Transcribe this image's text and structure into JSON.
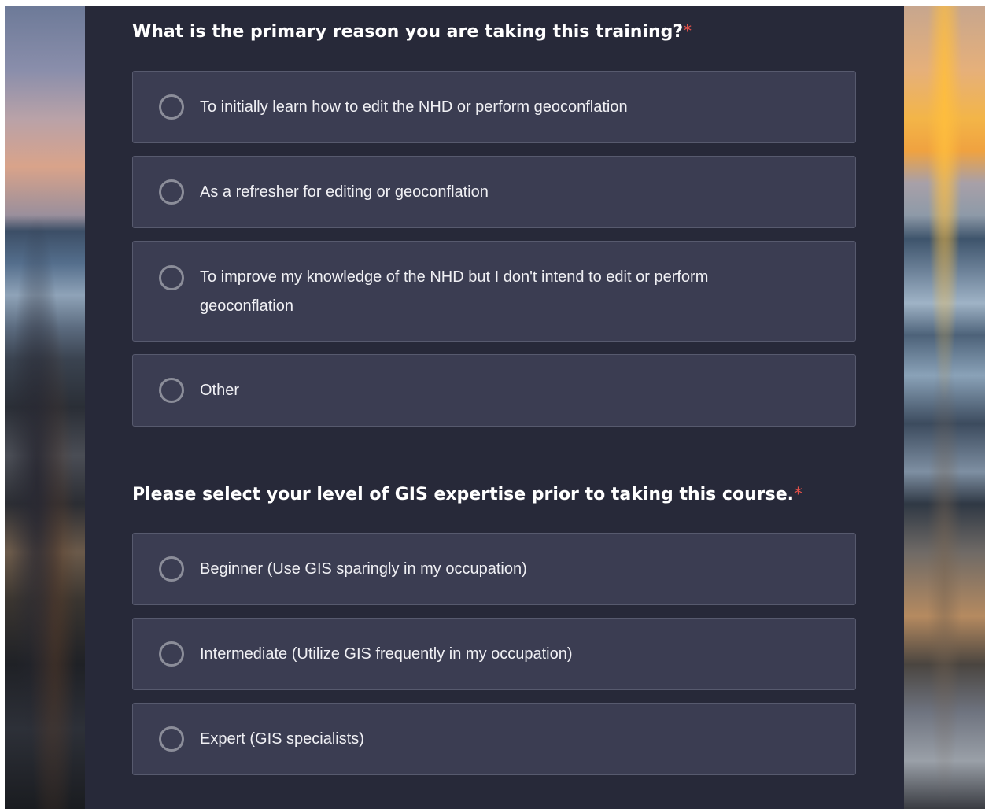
{
  "questions": [
    {
      "text": "What is the primary reason you are taking this training?",
      "required_mark": "*",
      "options": [
        {
          "label": "To initially learn how to edit the NHD or perform geoconflation"
        },
        {
          "label": "As a refresher for editing or geoconflation"
        },
        {
          "label": "To improve my knowledge of the NHD but I don't intend to edit or perform geoconflation"
        },
        {
          "label": "Other"
        }
      ]
    },
    {
      "text": "Please select your level of GIS expertise prior to taking this course.",
      "required_mark": "*",
      "options": [
        {
          "label": "Beginner (Use GIS sparingly in my occupation)"
        },
        {
          "label": "Intermediate (Utilize GIS frequently in my occupation)"
        },
        {
          "label": "Expert (GIS specialists)"
        }
      ]
    }
  ],
  "colors": {
    "panel_bg": "#272939",
    "option_bg": "#3b3d52",
    "option_border": "#575a6e",
    "radio_ring": "#8b8d99",
    "required_accent": "#e2514a",
    "text": "#ffffff"
  },
  "icons": {
    "radio": "radio-unselected-icon"
  }
}
